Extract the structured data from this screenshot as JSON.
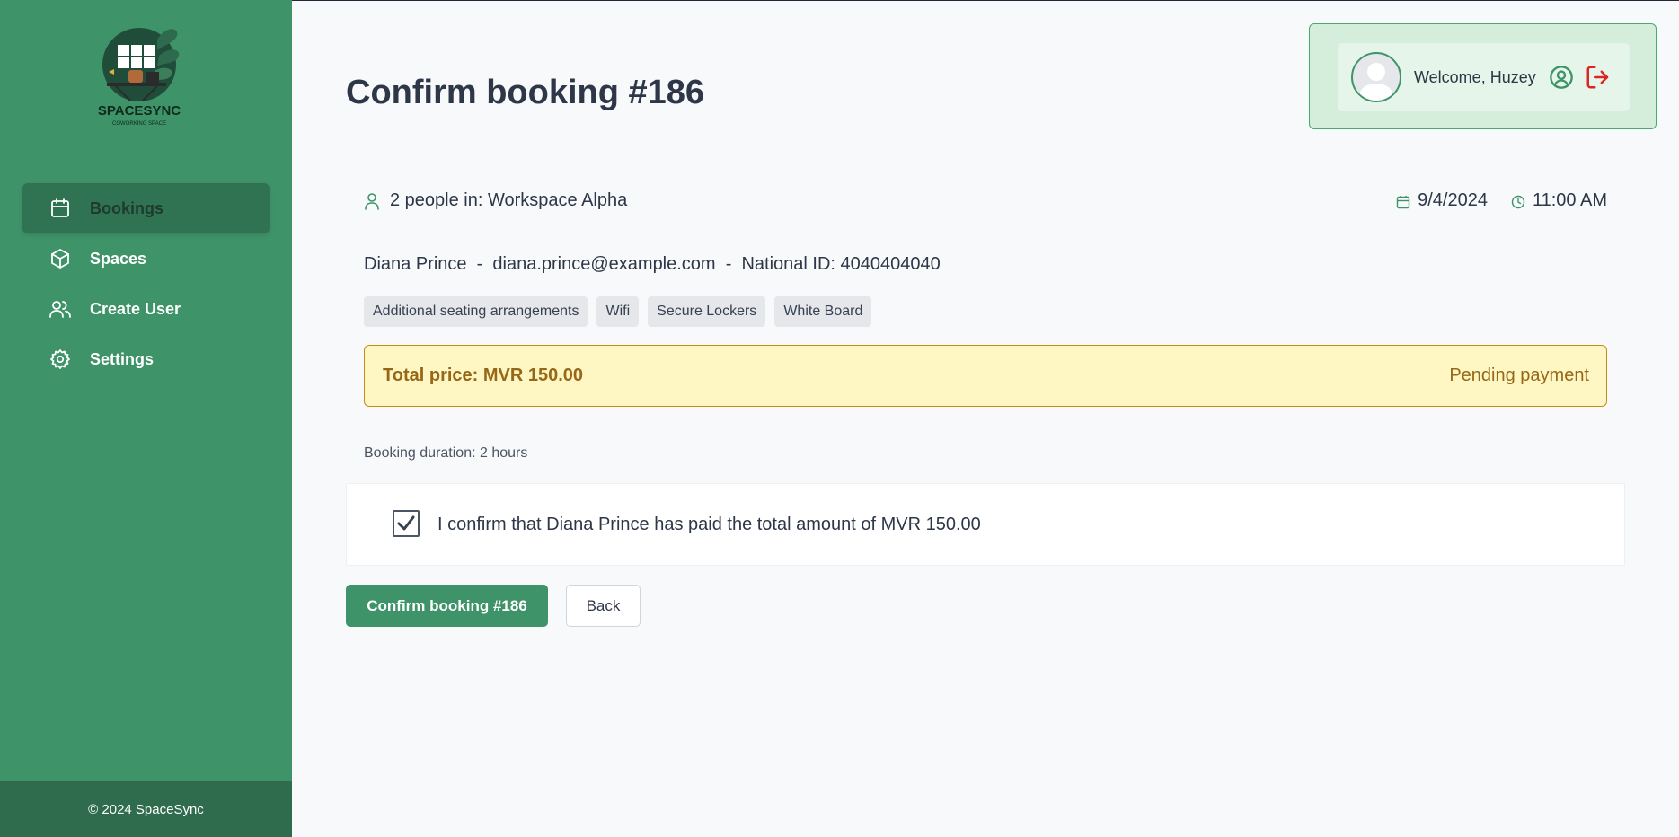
{
  "brand": {
    "name": "SPACESYNC",
    "tagline": "COWORKING SPACE"
  },
  "sidebar": {
    "items": [
      {
        "label": "Bookings",
        "icon": "calendar-icon",
        "active": true
      },
      {
        "label": "Spaces",
        "icon": "box-icon",
        "active": false
      },
      {
        "label": "Create User",
        "icon": "users-icon",
        "active": false
      },
      {
        "label": "Settings",
        "icon": "gear-icon",
        "active": false
      }
    ],
    "footer": "© 2024 SpaceSync"
  },
  "header": {
    "welcome": "Welcome, Huzey"
  },
  "booking": {
    "title": "Confirm booking #186",
    "people_space": "2 people in: Workspace Alpha",
    "date": "9/4/2024",
    "time": "11:00 AM",
    "person_line": "Diana Prince  -  diana.prince@example.com  -  National ID: 4040404040",
    "amenities": [
      "Additional seating arrangements",
      "Wifi",
      "Secure Lockers",
      "White Board"
    ],
    "total_price": "Total price: MVR 150.00",
    "payment_status": "Pending payment",
    "duration": "Booking duration: 2 hours",
    "confirmation_text": "I confirm that Diana Prince has paid the total amount of MVR 150.00",
    "confirmation_checked": true
  },
  "actions": {
    "confirm_label": "Confirm booking #186",
    "back_label": "Back"
  },
  "colors": {
    "sidebar": "#3f9369",
    "sidebar_active": "#2f7353",
    "footer": "#2f6b4d",
    "warning_bg": "#fef7c3",
    "warning_text": "#976617",
    "logout": "#dc2626"
  }
}
